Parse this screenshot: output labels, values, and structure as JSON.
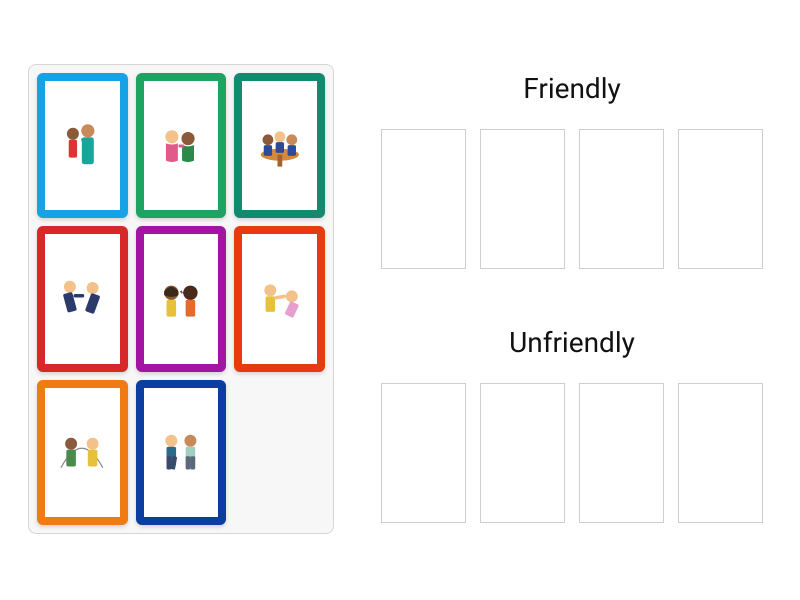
{
  "options": [
    {
      "title": "Friendly"
    },
    {
      "title": "Unfriendly"
    }
  ],
  "cards": [
    {
      "border": "#17a2e6",
      "name": "card-comforting-hug",
      "scene": "hug"
    },
    {
      "border": "#1ea362",
      "name": "card-consoling-friend",
      "scene": "console"
    },
    {
      "border": "#118a6f",
      "name": "card-eating-together",
      "scene": "table"
    },
    {
      "border": "#d62828",
      "name": "card-pushing",
      "scene": "push"
    },
    {
      "border": "#a314a3",
      "name": "card-yelling",
      "scene": "yell"
    },
    {
      "border": "#e63b12",
      "name": "card-hitting",
      "scene": "hit"
    },
    {
      "border": "#f07a13",
      "name": "card-jump-rope",
      "scene": "jumprope"
    },
    {
      "border": "#0b3ea1",
      "name": "card-walking-away",
      "scene": "walk"
    }
  ]
}
